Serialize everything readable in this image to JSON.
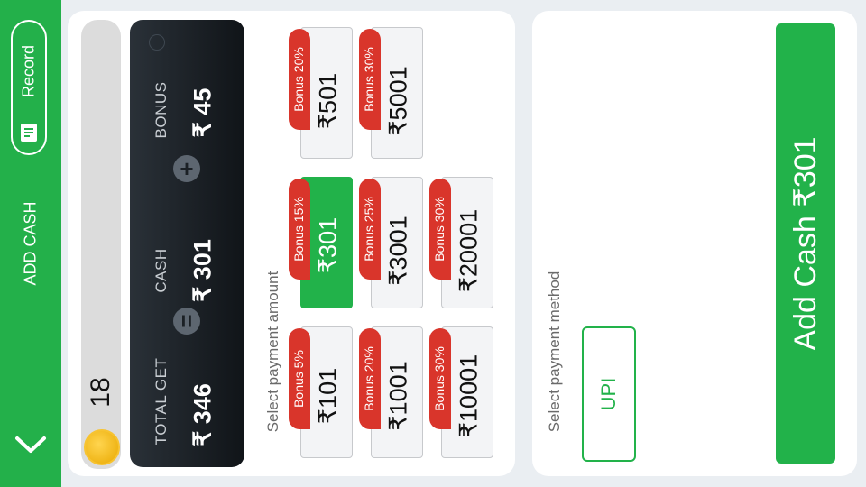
{
  "header": {
    "title": "ADD CASH",
    "record_label": "Record"
  },
  "balance": {
    "value": "18"
  },
  "summary": {
    "total_label": "TOTAL GET",
    "total_value": "₹ 346",
    "cash_label": "CASH",
    "cash_value": "₹ 301",
    "bonus_label": "BONUS",
    "bonus_value": "₹ 45",
    "equals_symbol": "=",
    "plus_symbol": "+"
  },
  "amount_section": {
    "title": "Select payment amount",
    "options": [
      {
        "amount": "₹101",
        "bonus": "Bonus 5%",
        "selected": false
      },
      {
        "amount": "₹301",
        "bonus": "Bonus 15%",
        "selected": true
      },
      {
        "amount": "₹501",
        "bonus": "Bonus 20%",
        "selected": false
      },
      {
        "amount": "₹1001",
        "bonus": "Bonus 20%",
        "selected": false
      },
      {
        "amount": "₹3001",
        "bonus": "Bonus 25%",
        "selected": false
      },
      {
        "amount": "₹5001",
        "bonus": "Bonus 30%",
        "selected": false
      },
      {
        "amount": "₹10001",
        "bonus": "Bonus 30%",
        "selected": false
      },
      {
        "amount": "₹20001",
        "bonus": "Bonus 30%",
        "selected": false
      }
    ]
  },
  "method_section": {
    "title": "Select payment method",
    "methods": [
      {
        "label": "UPI"
      }
    ]
  },
  "submit": {
    "label": "Add Cash ₹301"
  },
  "icons": {
    "back": "chevron-down-icon",
    "record": "record-doc-icon",
    "coin": "coin-icon",
    "info": "info-icon"
  },
  "colors": {
    "brand_green": "#23b04a",
    "bonus_red": "#d9352b",
    "card_dark": "#1c2227"
  }
}
